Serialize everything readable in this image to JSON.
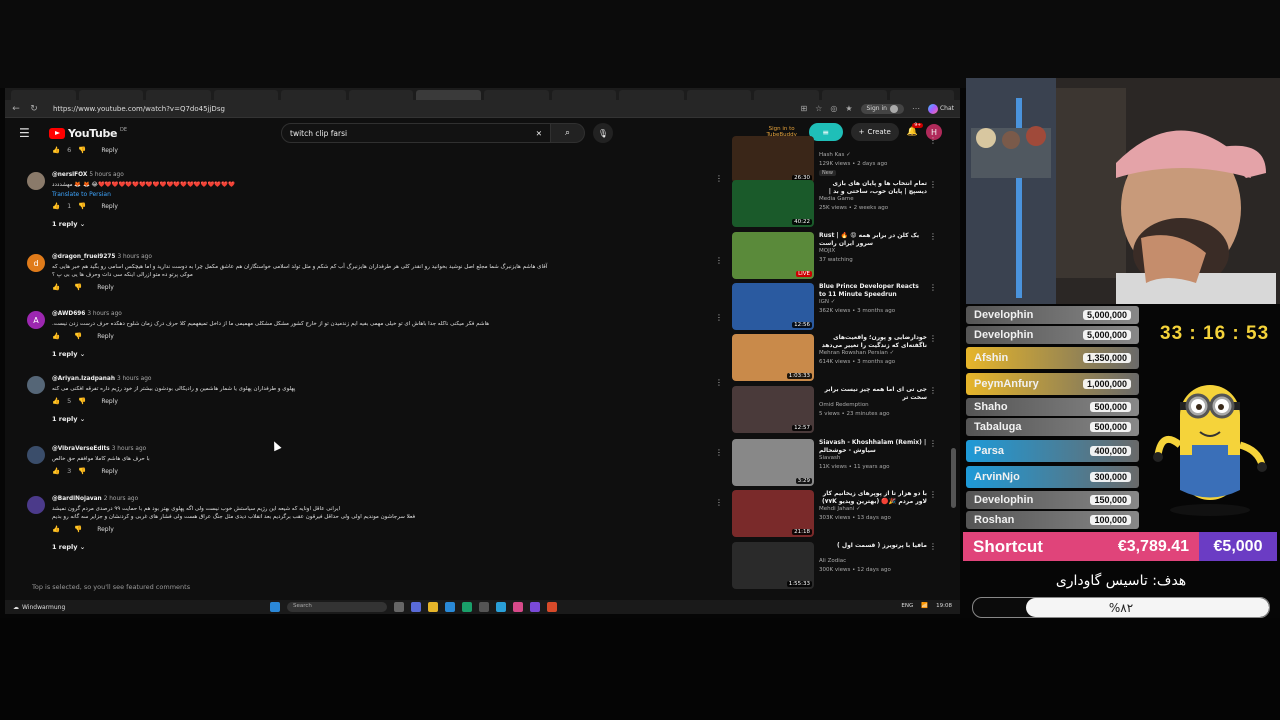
{
  "browser": {
    "tabs": [
      "",
      "",
      "",
      "",
      "",
      "",
      "",
      "",
      "",
      "",
      "",
      "",
      "",
      ""
    ],
    "url": "https://www.youtube.com/watch?v=Q7do45jjDsg",
    "signin": "Sign in",
    "chat": "Chat"
  },
  "youtube": {
    "logo_word": "YouTube",
    "logo_cc": "DE",
    "search_value": "twitch clip farsi",
    "tubebuddy": "Sign in to TubeBuddy",
    "create": "Create",
    "notif_count": "9+",
    "avatar_letter": "H"
  },
  "comments": {
    "top_actions": {
      "likes": "6",
      "reply": "Reply"
    },
    "items": [
      {
        "author": "@nersiFOX",
        "time": "5 hours ago",
        "avatar": "",
        "avatar_color": "#8a7a6a",
        "text": "❤️❤️❤️❤️❤️❤️❤️❤️❤️❤️❤️❤️❤️❤️❤️❤️❤️❤️❤️❤️😂 🦊 🦊 مهشدددد",
        "translate": "Translate to Persian",
        "likes": "1",
        "reply": "Reply",
        "replies": "1 reply"
      },
      {
        "author": "@dragon_fruei9275",
        "time": "3 hours ago",
        "avatar": "d",
        "avatar_color": "#e07b1a",
        "text": "آقای هاشم هایزنبرگ شما مجلع اصل نوشید بخوانید رو انقدر کلی هر طرفداران هایزنبرگ آب کم شکم و مثل تولد اسلامی خواستگاران هم عاشق مکمل چرا به دوست ندارید و اما هیچکس اسامی رو بگید هم خبر هایی که",
        "text2": "موکی پرتو ده متو ازرالی اینکه سی دات وحرف ها یی بی پ ؟",
        "likes": "",
        "reply": "Reply",
        "replies": ""
      },
      {
        "author": "@AWD696",
        "time": "3 hours ago",
        "avatar": "A",
        "avatar_color": "#9c27b0",
        "text": "هاشم فکر میکنی ناکله جدا باهاش ای تو خیلی مهمی بفیه ایم زندمیدن تو از خارج کشور مشکل مشکلی مهمیمی ما از داخل تمیفهمیم کلا حرف درک زمان شلوح دهکده حرف درست زدن نیست.",
        "likes": "",
        "reply": "Reply",
        "replies": "1 reply"
      },
      {
        "author": "@Ariyan.Izadpanah",
        "time": "3 hours ago",
        "avatar": "",
        "avatar_color": "#556677",
        "text": "پهلوی و طرفداران پهلوی یا شمار هاشمین و رادیکالی بودشون بیشتر از خود رژیم داره تفرقه افکنی می کنه",
        "likes": "5",
        "reply": "Reply",
        "replies": "1 reply"
      },
      {
        "author": "@VibraVerseEdits",
        "time": "3 hours ago",
        "avatar": "",
        "avatar_color": "#3a4d6a",
        "text": "با حرف های هاشم کاملا موافقم حق خالص",
        "likes": "3",
        "reply": "Reply",
        "replies": ""
      },
      {
        "author": "@BardiNojavan",
        "time": "2 hours ago",
        "avatar": "",
        "avatar_color": "#4b3a8a",
        "text": "ایرانی عاقل اونایه که شیعه این رژیم سیاستش خوب نیست ولی اگه پهلوی بهتر بود هم با حمایت ۹۹ درصدی مردم گرون نمیشد",
        "text2": "فعلا سرجاشون موندیم اولی ولی حداقل فیرقون عقب برگردیم بعد انقلاب دیدی مثل جنگ عراق هست ولی فشار های غربی و کردنشان و جزایر سه گانه رو بدیم",
        "likes": "",
        "reply": "Reply",
        "replies": "1 reply"
      }
    ],
    "top_selected": "Top is selected, so you'll see featured comments"
  },
  "sidebar": {
    "videos": [
      {
        "title": "",
        "channel": "Hash Kas ✓",
        "meta": "129K views • 2 days ago",
        "badge": "New",
        "duration": "26:30",
        "thumb": "#3a2618"
      },
      {
        "title": "تمام انتخاب ها و پایان های بازی دیسپچ | پایان خوب، ساختی و بد | Dispatch All",
        "channel": "Media Game",
        "meta": "25K views • 2 weeks ago",
        "badge": "",
        "duration": "40:22",
        "thumb": "#1a5a2a"
      },
      {
        "title": "Rust | 🔥 😡 یک کلن در برابر همه سرور ایران راست",
        "channel": "MOJIX",
        "meta": "37 watching",
        "badge": "",
        "duration": "LIVE",
        "thumb": "#5a8a3a"
      },
      {
        "title": "Blue Prince Developer Reacts to 11 Minute Speedrun",
        "channel": "IGN ✓",
        "meta": "362K views • 3 months ago",
        "badge": "",
        "duration": "12:56",
        "thumb": "#2a5aa0"
      },
      {
        "title": "خودارضایی و پورن؛ واقعیت‌های ناگفته‌ای که زندگیت را تغییر می‌دهد",
        "channel": "Mehran Rowshan Persian ✓",
        "meta": "614K views • 3 months ago",
        "badge": "",
        "duration": "1:03:33",
        "thumb": "#c98a4a"
      },
      {
        "title": "جی تی ای اما همه چیز نیست برابر سخت تر",
        "channel": "Omid Redemption",
        "meta": "5 views • 23 minutes ago",
        "badge": "",
        "duration": "12:57",
        "thumb": "#4a3a3a"
      },
      {
        "title": "Siavash - Khoshhalam (Remix) | سیاوش - خوشحالم",
        "channel": "Siavash",
        "meta": "11K views • 11 years ago",
        "badge": "",
        "duration": "3:29",
        "thumb": "#888888"
      },
      {
        "title": "با دو هزار تا از پوپرهای زیخانیم کار لاور مردم 🎉🔴 (بهترین ویدیو ۷۷K) ✖",
        "channel": "Mehdi Jahani ✓",
        "meta": "303K views • 13 days ago",
        "badge": "",
        "duration": "21:18",
        "thumb": "#7a2a2a"
      },
      {
        "title": "مافیا با پرتویرز ( قسمت اول )",
        "channel": "Ali Zodiac",
        "meta": "300K views • 12 days ago",
        "badge": "",
        "duration": "1:55:33",
        "thumb": "#2a2a2a"
      }
    ]
  },
  "taskbar": {
    "start_label": "Windwarmung",
    "search": "Search",
    "lang": "ENG",
    "clock": "19:08"
  },
  "overlay": {
    "donors": [
      {
        "name": "Develophin",
        "amount": "5,000,000",
        "color": "#8a8a8a"
      },
      {
        "name": "Develophin",
        "amount": "5,000,000",
        "color": "#8a8a8a"
      },
      {
        "name": "Afshin",
        "amount": "1,350,000",
        "color": "#e6b52a"
      },
      {
        "name": "PeymAnfury",
        "amount": "1,000,000",
        "color": "#e6b52a"
      },
      {
        "name": "Shaho",
        "amount": "500,000",
        "color": "#8a8a8a"
      },
      {
        "name": "Tabaluga",
        "amount": "500,000",
        "color": "#8a8a8a"
      },
      {
        "name": "Parsa",
        "amount": "400,000",
        "color": "#1e9ad8"
      },
      {
        "name": "ArvinNjo",
        "amount": "300,000",
        "color": "#1e9ad8"
      },
      {
        "name": "Develophin",
        "amount": "150,000",
        "color": "#8a8a8a"
      },
      {
        "name": "Roshan",
        "amount": "100,000",
        "color": "#8a8a8a"
      }
    ],
    "timer": "33 : 16 : 53",
    "goal_name": "Shortcut",
    "goal_current": "€3,789.41",
    "goal_target": "€5,000",
    "goal_title": "هدف: تاسیس گاوداری",
    "goal_percent_text": "%۸۲",
    "goal_fraction": 0.82
  }
}
